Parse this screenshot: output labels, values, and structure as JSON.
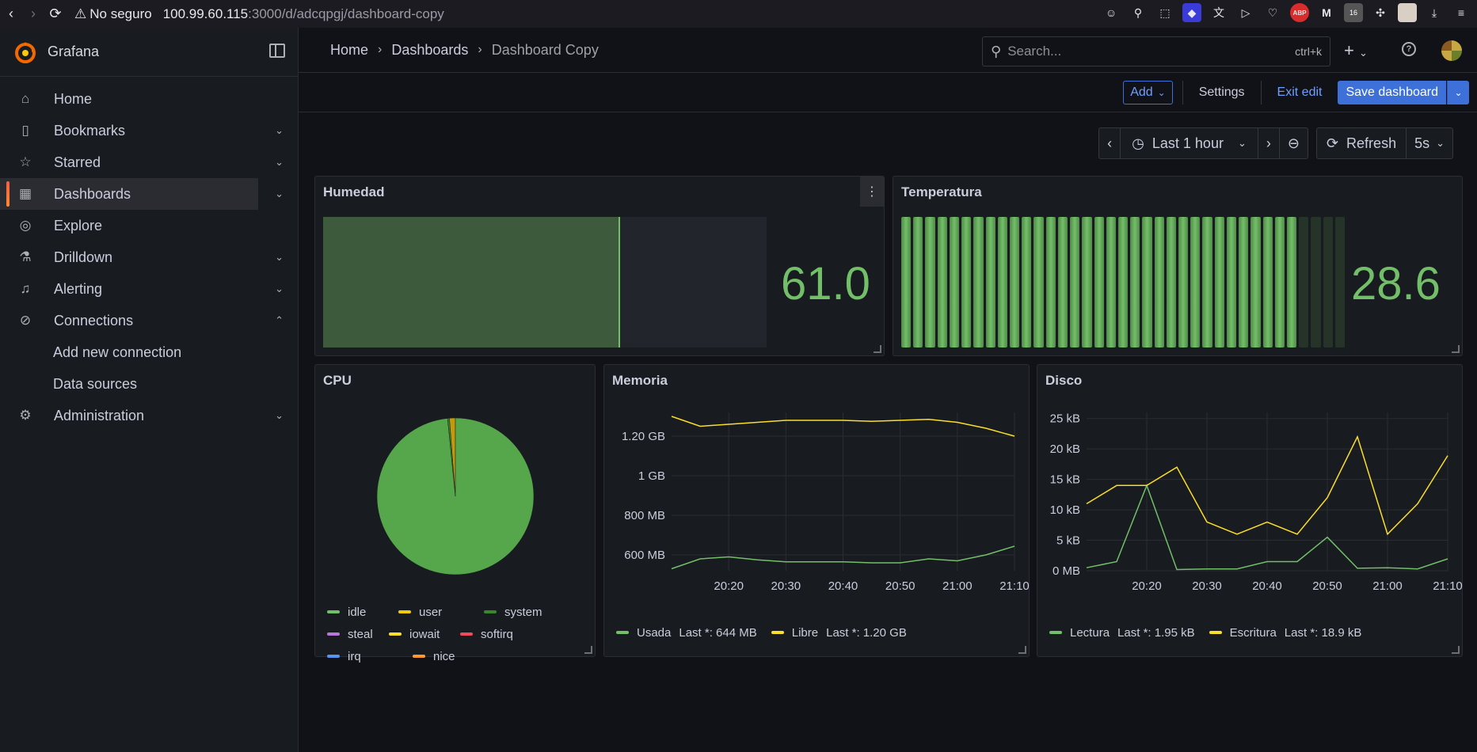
{
  "browser": {
    "insecure_label": "No seguro",
    "url_host": "100.99.60.115",
    "url_path": ":3000/d/adcqpgj/dashboard-copy",
    "extension_badge": "16",
    "abp_label": "ABP"
  },
  "sidebar": {
    "brand": "Grafana",
    "items": [
      {
        "label": "Home",
        "icon": "home-icon"
      },
      {
        "label": "Bookmarks",
        "icon": "bookmark-icon"
      },
      {
        "label": "Starred",
        "icon": "star-icon"
      },
      {
        "label": "Dashboards",
        "icon": "apps-icon"
      },
      {
        "label": "Explore",
        "icon": "compass-icon"
      },
      {
        "label": "Drilldown",
        "icon": "drilldown-icon"
      },
      {
        "label": "Alerting",
        "icon": "bell-icon"
      },
      {
        "label": "Connections",
        "icon": "connections-icon"
      },
      {
        "label": "Add new connection"
      },
      {
        "label": "Data sources"
      },
      {
        "label": "Administration",
        "icon": "gear-icon"
      }
    ]
  },
  "header": {
    "breadcrumbs": [
      "Home",
      "Dashboards",
      "Dashboard Copy"
    ],
    "search_placeholder": "Search...",
    "search_shortcut": "ctrl+k"
  },
  "toolbar": {
    "add_label": "Add",
    "settings_label": "Settings",
    "exit_label": "Exit edit",
    "save_label": "Save dashboard"
  },
  "time": {
    "range": "Last 1 hour",
    "refresh_label": "Refresh",
    "interval": "5s"
  },
  "panels": {
    "humedad": {
      "title": "Humedad",
      "value": "61.0",
      "fill": 0.67
    },
    "temperatura": {
      "title": "Temperatura",
      "value": "28.6",
      "fill": 0.89
    },
    "cpu": {
      "title": "CPU",
      "legend": [
        "idle",
        "user",
        "system",
        "steal",
        "iowait",
        "softirq",
        "irq",
        "nice"
      ],
      "colors": [
        "#73bf69",
        "#f2cc0c",
        "#37872d",
        "#b877d9",
        "#fade2a",
        "#f2495c",
        "#5794f2",
        "#ff9830"
      ]
    },
    "memoria": {
      "title": "Memoria",
      "legend": [
        {
          "name": "Usada",
          "last": "Last *: 644 MB",
          "color": "#73bf69"
        },
        {
          "name": "Libre",
          "last": "Last *: 1.20 GB",
          "color": "#fade2a"
        }
      ]
    },
    "disco": {
      "title": "Disco",
      "legend": [
        {
          "name": "Lectura",
          "last": "Last *: 1.95 kB",
          "color": "#73bf69"
        },
        {
          "name": "Escritura",
          "last": "Last *: 18.9 kB",
          "color": "#fade2a"
        }
      ]
    }
  },
  "chart_data": [
    {
      "type": "pie",
      "title": "CPU",
      "categories": [
        "idle",
        "user",
        "system",
        "steal",
        "iowait",
        "softirq",
        "irq",
        "nice"
      ],
      "values": [
        98.4,
        1.2,
        0.4,
        0,
        0,
        0,
        0,
        0
      ]
    },
    {
      "type": "line",
      "title": "Memoria",
      "x": [
        "20:10",
        "20:15",
        "20:20",
        "20:25",
        "20:30",
        "20:35",
        "20:40",
        "20:45",
        "20:50",
        "20:55",
        "21:00",
        "21:05",
        "21:10"
      ],
      "xticks": [
        "20:20",
        "20:30",
        "20:40",
        "20:50",
        "21:00",
        "21:10"
      ],
      "yticks": [
        "600 MB",
        "800 MB",
        "1 GB",
        "1.20 GB"
      ],
      "ylim": [
        520,
        1320
      ],
      "series": [
        {
          "name": "Usada",
          "values": [
            530,
            580,
            590,
            575,
            565,
            565,
            565,
            560,
            560,
            580,
            570,
            600,
            644
          ]
        },
        {
          "name": "Libre",
          "values": [
            1300,
            1250,
            1260,
            1270,
            1280,
            1280,
            1280,
            1275,
            1280,
            1285,
            1270,
            1240,
            1200
          ]
        }
      ]
    },
    {
      "type": "line",
      "title": "Disco",
      "x": [
        "20:10",
        "20:15",
        "20:20",
        "20:25",
        "20:30",
        "20:35",
        "20:40",
        "20:45",
        "20:50",
        "20:55",
        "21:00",
        "21:05",
        "21:10"
      ],
      "xticks": [
        "20:20",
        "20:30",
        "20:40",
        "20:50",
        "21:00",
        "21:10"
      ],
      "yticks": [
        "0 MB",
        "5 kB",
        "10 kB",
        "15 kB",
        "20 kB",
        "25 kB"
      ],
      "ylim": [
        0,
        26
      ],
      "series": [
        {
          "name": "Lectura",
          "values": [
            0.5,
            1.5,
            14,
            0.2,
            0.3,
            0.3,
            1.5,
            1.5,
            5.5,
            0.4,
            0.5,
            0.3,
            1.95
          ]
        },
        {
          "name": "Escritura",
          "values": [
            11,
            14,
            14,
            17,
            8,
            6,
            8,
            6,
            12,
            22,
            6,
            11,
            18.9
          ]
        }
      ]
    }
  ]
}
